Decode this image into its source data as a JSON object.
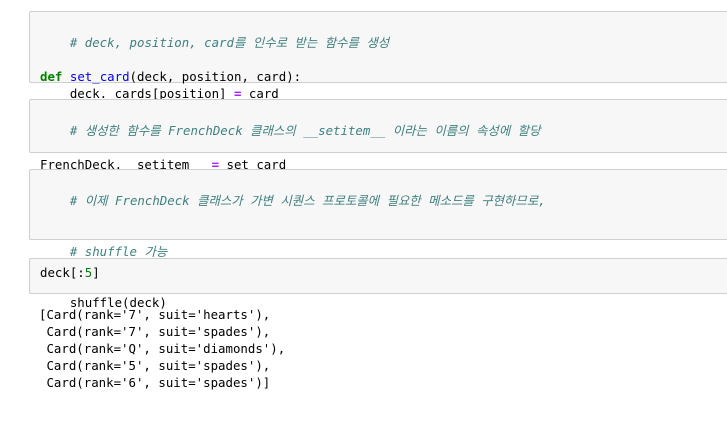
{
  "cell1": {
    "comment": "# deck, position, card를 인수로 받는 함수를 생성",
    "def_keyword": "def",
    "func_name": "set_card",
    "params": "(deck, position, card):",
    "body_lhs": "    deck._cards[position] ",
    "body_op": "=",
    "body_rhs": " card"
  },
  "cell2": {
    "comment": "# 생성한 함수를 FrenchDeck 클래스의 __setitem__ 이라는 이름의 속성에 할당",
    "lhs": "FrenchDeck.__setitem__ ",
    "op": "=",
    "rhs": " set_card"
  },
  "cell3": {
    "comment_line1": "# 이제 FrenchDeck 클래스가 가변 시퀀스 프로토콜에 필요한 메소드를 구현하므로,",
    "comment_line2": "# shuffle 가능",
    "call": "shuffle(deck)"
  },
  "cell4": {
    "code_prefix": "deck[:",
    "code_number": "5",
    "code_suffix": "]"
  },
  "output": {
    "lines": [
      "[Card(rank='7', suit='hearts'),",
      " Card(rank='7', suit='spades'),",
      " Card(rank='Q', suit='diamonds'),",
      " Card(rank='5', suit='spades'),",
      " Card(rank='6', suit='spades')]"
    ]
  },
  "colors": {
    "comment": "#408080",
    "keyword": "#008000",
    "function_name": "#0000ff",
    "operator": "#aa22ff",
    "cell_background": "#f7f7f7",
    "cell_border": "#cfcfcf"
  }
}
